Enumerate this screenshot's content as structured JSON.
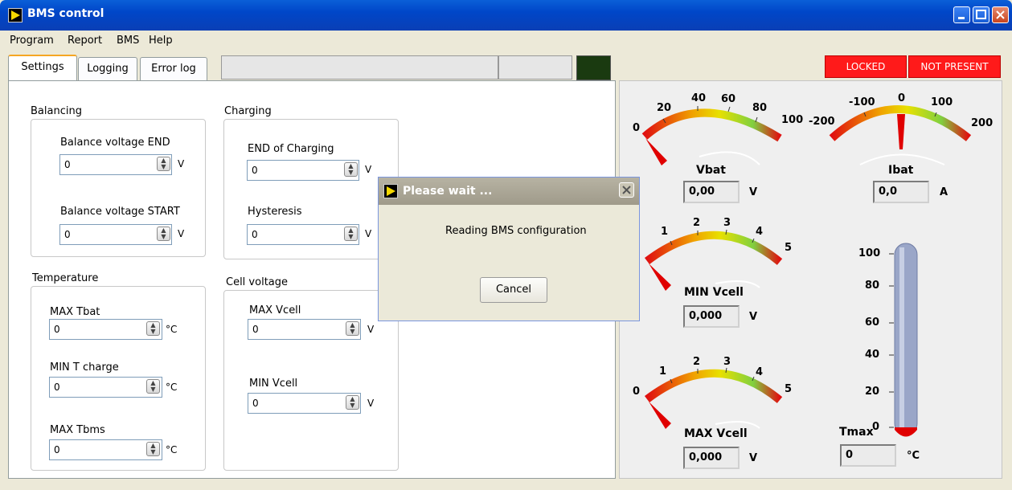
{
  "window": {
    "title": "BMS control"
  },
  "menu": [
    "Program",
    "Report",
    "BMS",
    "Help"
  ],
  "tabs": [
    "Settings",
    "Logging",
    "Error log"
  ],
  "indicators": {
    "locked": "LOCKED",
    "present": "NOT PRESENT",
    "color": "#ff1a1a"
  },
  "balancing": {
    "title": "Balancing",
    "end_label": "Balance voltage END",
    "end_value": "0",
    "end_unit": "V",
    "start_label": "Balance voltage START",
    "start_value": "0",
    "start_unit": "V"
  },
  "charging": {
    "title": "Charging",
    "end_label": "END of Charging",
    "end_value": "0",
    "end_unit": "V",
    "hyst_label": "Hysteresis",
    "hyst_value": "0",
    "hyst_unit": "V"
  },
  "temperature": {
    "title": "Temperature",
    "max_tbat_label": "MAX Tbat",
    "max_tbat_value": "0",
    "max_tbat_unit": "°C",
    "min_tcharge_label": "MIN T charge",
    "min_tcharge_value": "0",
    "min_tcharge_unit": "°C",
    "max_tbms_label": "MAX Tbms",
    "max_tbms_value": "0",
    "max_tbms_unit": "°C"
  },
  "cell_voltage": {
    "title": "Cell voltage",
    "max_label": "MAX Vcell",
    "max_value": "0",
    "max_unit": "V",
    "min_label": "MIN Vcell",
    "min_value": "0",
    "min_unit": "V"
  },
  "gauges": {
    "vbat": {
      "label": "Vbat",
      "value": "0,00",
      "unit": "V",
      "ticks": [
        "0",
        "20",
        "40",
        "60",
        "80",
        "100"
      ]
    },
    "ibat": {
      "label": "Ibat",
      "value": "0,0",
      "unit": "A",
      "ticks": [
        "-200",
        "-100",
        "0",
        "100",
        "200"
      ]
    },
    "min_vcell": {
      "label": "MIN Vcell",
      "value": "0,000",
      "unit": "V",
      "ticks": [
        "1",
        "2",
        "3",
        "4",
        "5"
      ]
    },
    "max_vcell": {
      "label": "MAX Vcell",
      "value": "0,000",
      "unit": "V",
      "ticks": [
        "0",
        "1",
        "2",
        "3",
        "4",
        "5"
      ]
    }
  },
  "thermometer": {
    "label": "Tmax",
    "value": "0",
    "unit": "°C",
    "ticks": [
      "100",
      "80",
      "60",
      "40",
      "20",
      "0"
    ]
  },
  "dialog": {
    "title": "Please wait ...",
    "message": "Reading BMS configuration",
    "cancel": "Cancel"
  }
}
